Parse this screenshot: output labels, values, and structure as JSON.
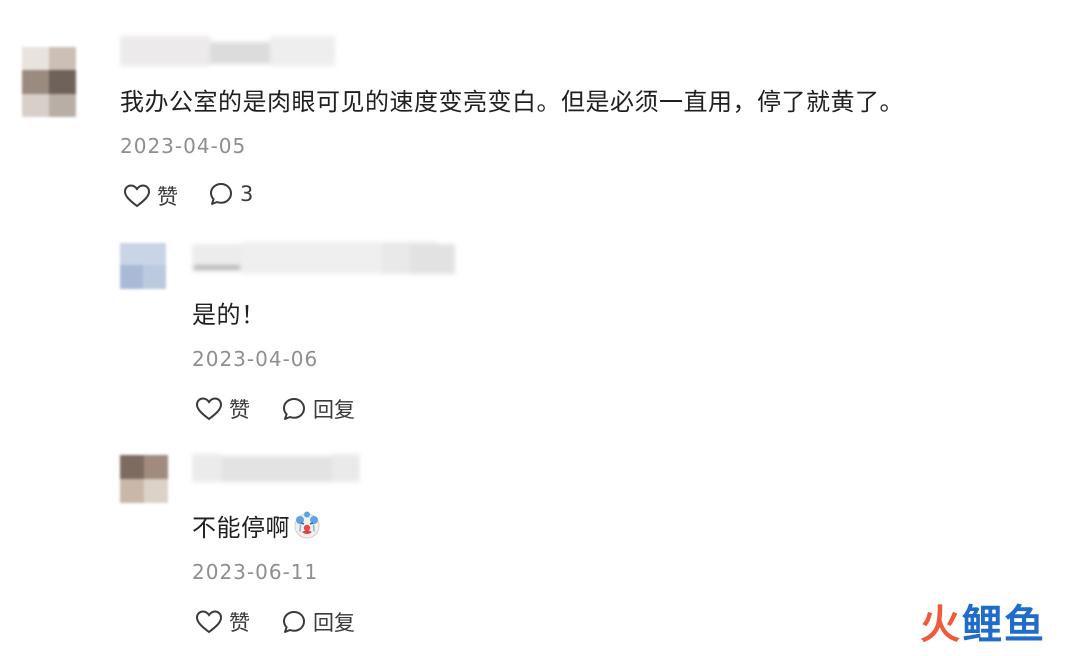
{
  "comments": [
    {
      "text": "我办公室的是肉眼可见的速度变亮变白。但是必须一直用，停了就黄了。",
      "date": "2023-04-05",
      "like_label": "赞",
      "reply_count": "3"
    },
    {
      "text": "是的！",
      "date": "2023-04-06",
      "like_label": "赞",
      "reply_label": "回复"
    },
    {
      "text": "不能停啊",
      "date": "2023-06-11",
      "like_label": "赞",
      "reply_label": "回复",
      "emoji": "crying-clown-face"
    }
  ],
  "watermark": {
    "part1": "火",
    "part2": "鲤鱼"
  },
  "icons": {
    "like": "heart-outline-icon",
    "comment": "speech-bubble-outline-icon"
  },
  "colors": {
    "date": "#8e8e8e",
    "watermark_fire": "#ee5a3a",
    "watermark_blue": "#1f6cc9"
  }
}
